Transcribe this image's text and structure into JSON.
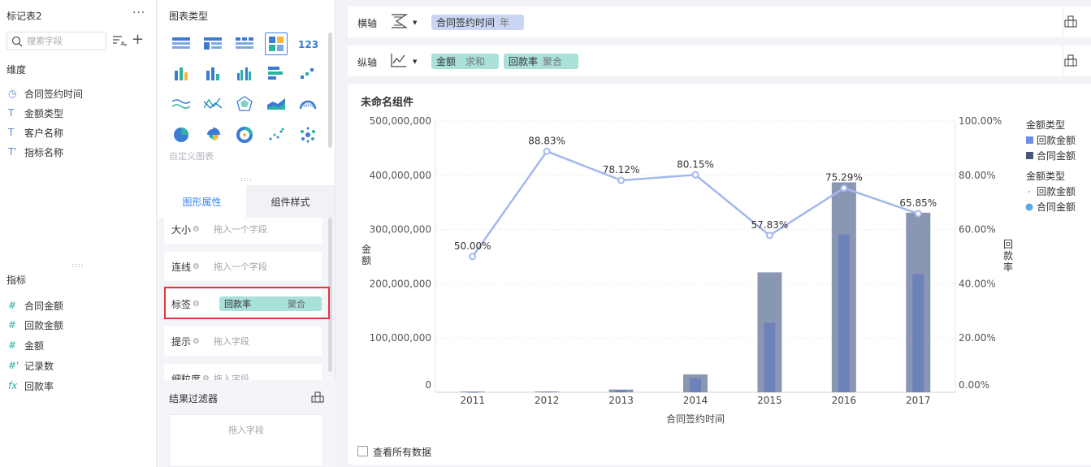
{
  "left_panel": {
    "title": "标记表2",
    "more": "···",
    "search_placeholder": "搜索字段",
    "dimensions_header": "维度",
    "dimensions": [
      {
        "icon": "clock-icon",
        "glyph": "◷",
        "label": "合同签约时间"
      },
      {
        "icon": "text-type-icon",
        "glyph": "T",
        "label": "金额类型"
      },
      {
        "icon": "text-type-icon",
        "glyph": "T",
        "label": "客户名称"
      },
      {
        "icon": "text-calc-icon",
        "glyph": "T'",
        "label": "指标名称"
      }
    ],
    "measures_header": "指标",
    "measures": [
      {
        "icon": "number-icon",
        "glyph": "#",
        "label": "合同金额"
      },
      {
        "icon": "number-icon",
        "glyph": "#",
        "label": "回款金额"
      },
      {
        "icon": "number-icon",
        "glyph": "#",
        "label": "金额"
      },
      {
        "icon": "number-calc-icon",
        "glyph": "#'",
        "label": "记录数"
      },
      {
        "icon": "formula-icon",
        "glyph": "fx",
        "label": "回款率"
      }
    ]
  },
  "middle_panel": {
    "chart_types_title": "图表类型",
    "custom_chart": "自定义图表",
    "tabs": [
      {
        "label": "图形属性",
        "active": true
      },
      {
        "label": "组件样式",
        "active": false
      }
    ],
    "properties": [
      {
        "label": "大小",
        "placeholder": "拖入一个字段"
      },
      {
        "label": "连线",
        "placeholder": "拖入一个字段"
      },
      {
        "label": "标签",
        "field": "回款率",
        "agg": "聚合"
      },
      {
        "label": "提示",
        "placeholder": "拖入字段"
      },
      {
        "label": "细粒度",
        "placeholder": "拖入字段"
      }
    ],
    "result_filter_title": "结果过滤器",
    "drop_placeholder": "拖入字段"
  },
  "shelves": {
    "x_label": "横轴",
    "x_pills": [
      {
        "field": "合同签约时间",
        "sub": "年"
      }
    ],
    "y_label": "纵轴",
    "y_pills": [
      {
        "field": "金额",
        "sub": "求和"
      },
      {
        "field": "回款率",
        "sub": "聚合"
      }
    ]
  },
  "chart_title": "未命名组件",
  "view_all": "查看所有数据",
  "colors": {
    "accent": "#3685f2",
    "bar_outer": "#8a97b3",
    "bar_inner": "#6d82b8",
    "line": "#a3b8ec",
    "legend_blue": "#6d8ee6",
    "legend_navy": "#4a5775",
    "legend_dot": "#5aa8e6"
  },
  "chart_data": {
    "type": "bar",
    "title": "未命名组件",
    "xlabel": "合同签约时间",
    "ylabel": "金额",
    "y2label": "回款率",
    "categories": [
      "2011",
      "2012",
      "2013",
      "2014",
      "2015",
      "2016",
      "2017"
    ],
    "ylim": [
      0,
      500000000
    ],
    "yticks": [
      "0",
      "100,000,000",
      "200,000,000",
      "300,000,000",
      "400,000,000",
      "500,000,000"
    ],
    "y2lim": [
      0,
      100
    ],
    "y2ticks": [
      "0.00%",
      "20.00%",
      "40.00%",
      "60.00%",
      "80.00%",
      "100.00%"
    ],
    "series": [
      {
        "name": "合同金额",
        "kind": "bar",
        "values": [
          1500000,
          1500000,
          5000000,
          33000000,
          221000000,
          387000000,
          331000000
        ]
      },
      {
        "name": "回款金额",
        "kind": "bar",
        "values": [
          750000,
          1330000,
          3900000,
          26000000,
          128000000,
          291000000,
          218000000
        ]
      },
      {
        "name": "回款率",
        "kind": "line",
        "values": [
          50.0,
          88.83,
          78.12,
          80.15,
          57.83,
          75.29,
          65.85
        ],
        "labels": [
          "50.00%",
          "88.83%",
          "78.12%",
          "80.15%",
          "57.83%",
          "75.29%",
          "65.85%"
        ]
      }
    ],
    "legend": [
      {
        "title": "金额类型",
        "items": [
          {
            "name": "回款金额",
            "shape": "square",
            "color": "#6d8ee6"
          },
          {
            "name": "合同金额",
            "shape": "square",
            "color": "#4a5775"
          }
        ]
      },
      {
        "title": "金额类型",
        "items": [
          {
            "name": "回款金额",
            "shape": "small-dot",
            "color": "#9aa0aa"
          },
          {
            "name": "合同金额",
            "shape": "dot",
            "color": "#5aa8e6"
          }
        ]
      }
    ],
    "legend_position": "right",
    "grid": true
  }
}
